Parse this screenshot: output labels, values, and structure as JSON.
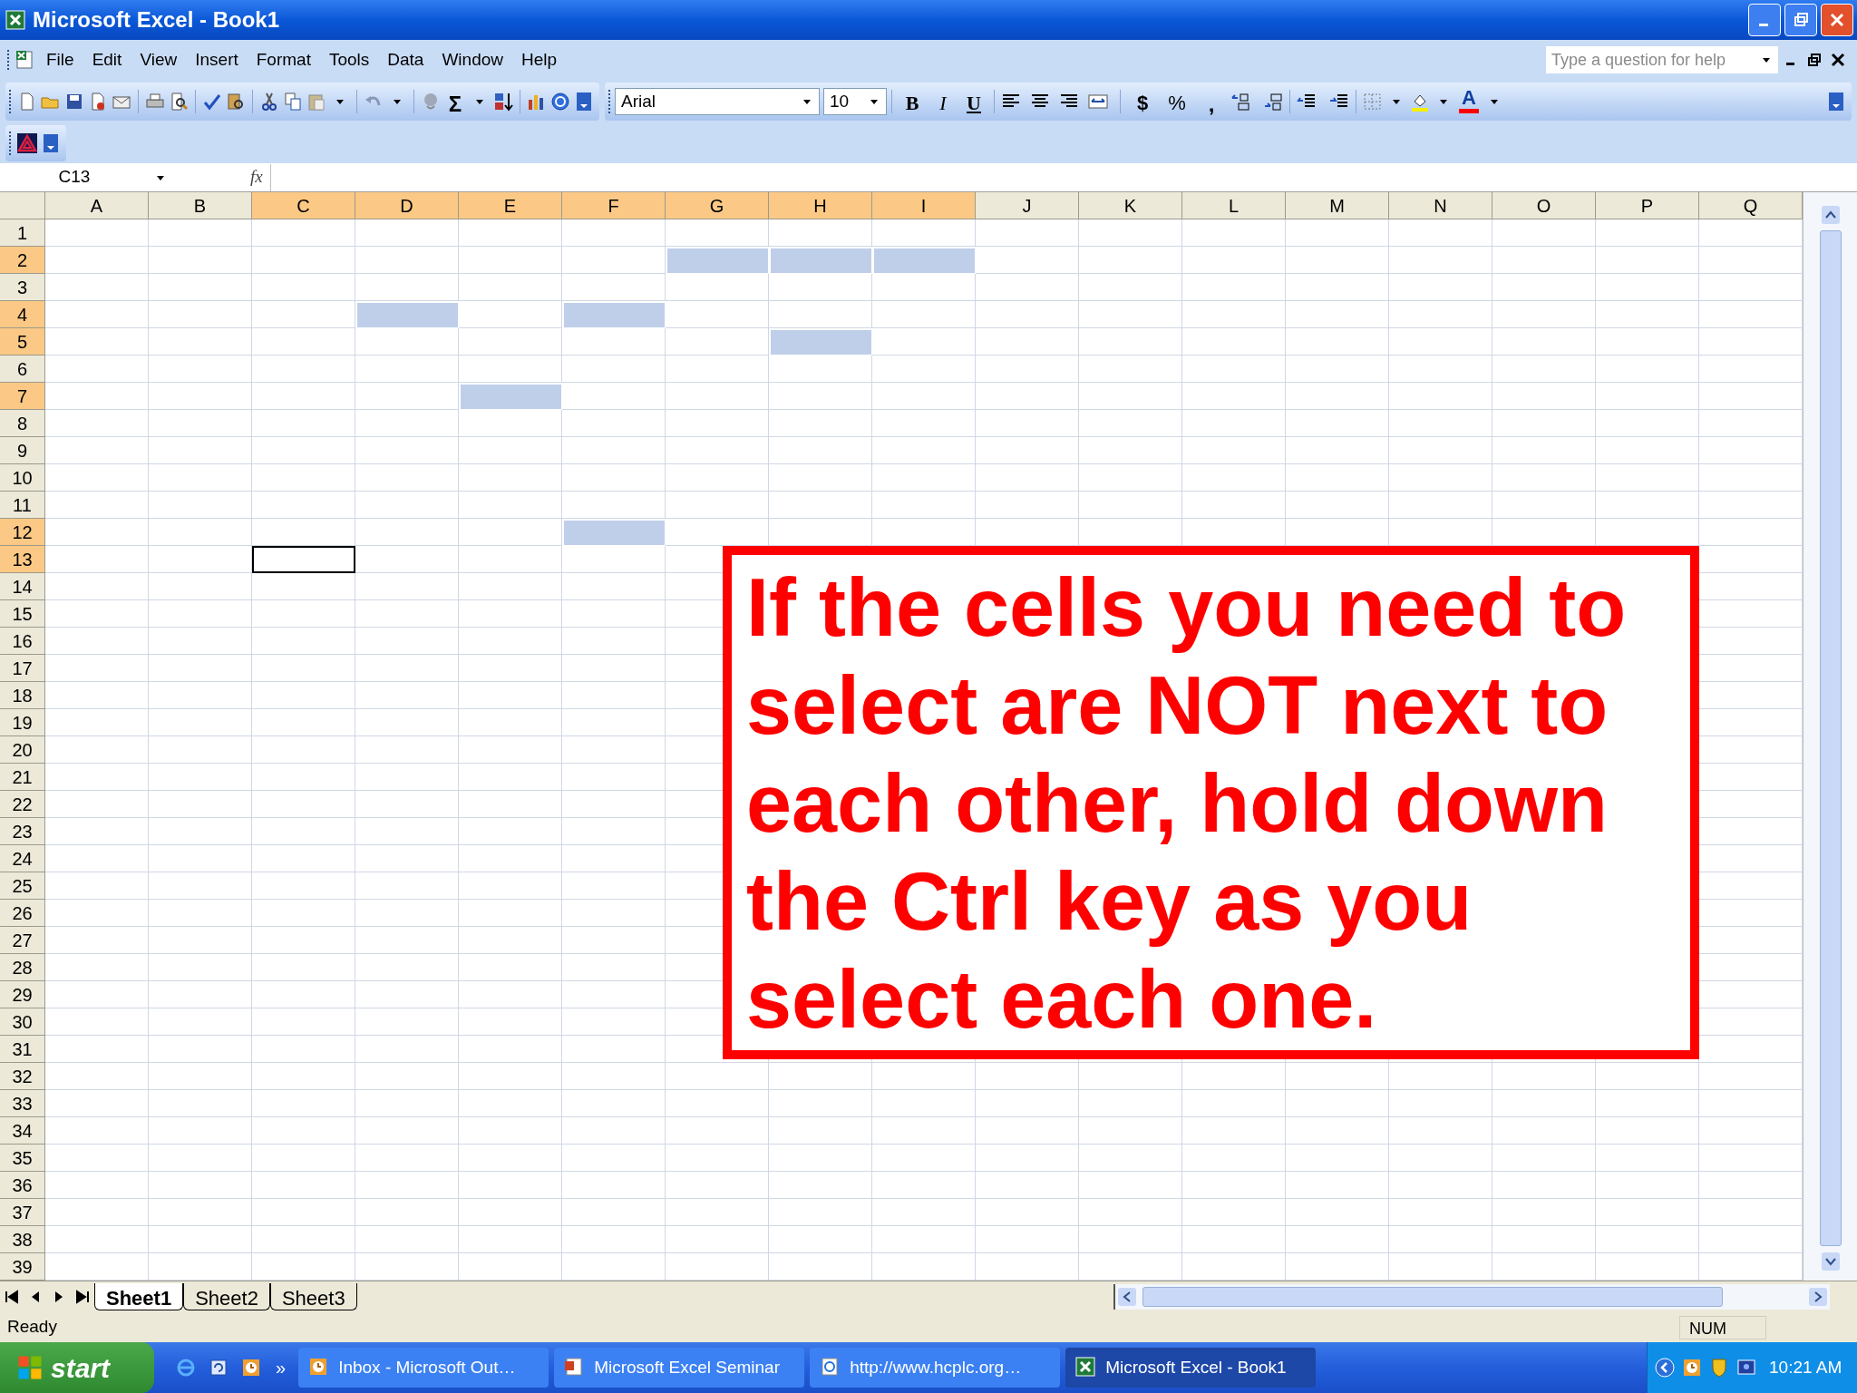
{
  "window": {
    "title": "Microsoft Excel - Book1"
  },
  "menu": [
    "File",
    "Edit",
    "View",
    "Insert",
    "Format",
    "Tools",
    "Data",
    "Window",
    "Help"
  ],
  "help_box": {
    "placeholder": "Type a question for help"
  },
  "standard_toolbar": {
    "autosum": "Σ"
  },
  "formatting_toolbar": {
    "font": "Arial",
    "size": "10",
    "bold": "B",
    "italic": "I",
    "underline": "U",
    "currency": "$",
    "percent": "%",
    "comma": ",",
    "font_color": "A"
  },
  "formula_bar": {
    "name_box": "C13",
    "fx": "fx"
  },
  "columns": [
    {
      "label": "A",
      "selected": false
    },
    {
      "label": "B",
      "selected": false
    },
    {
      "label": "C",
      "selected": true,
      "active": true
    },
    {
      "label": "D",
      "selected": true
    },
    {
      "label": "E",
      "selected": true
    },
    {
      "label": "F",
      "selected": true
    },
    {
      "label": "G",
      "selected": true
    },
    {
      "label": "H",
      "selected": true
    },
    {
      "label": "I",
      "selected": true
    },
    {
      "label": "J",
      "selected": false
    },
    {
      "label": "K",
      "selected": false
    },
    {
      "label": "L",
      "selected": false
    },
    {
      "label": "M",
      "selected": false
    },
    {
      "label": "N",
      "selected": false
    },
    {
      "label": "O",
      "selected": false
    },
    {
      "label": "P",
      "selected": false
    },
    {
      "label": "Q",
      "selected": false
    }
  ],
  "rows": [
    {
      "label": "1",
      "selected": false
    },
    {
      "label": "2",
      "selected": true,
      "cell_selected": [
        false,
        false,
        false,
        false,
        false,
        false,
        true,
        true,
        true,
        false,
        false,
        false,
        false,
        false,
        false,
        false,
        false
      ]
    },
    {
      "label": "3",
      "selected": false
    },
    {
      "label": "4",
      "selected": true,
      "cell_selected": [
        false,
        false,
        false,
        true,
        false,
        true,
        false,
        false,
        false,
        false,
        false,
        false,
        false,
        false,
        false,
        false,
        false
      ]
    },
    {
      "label": "5",
      "selected": true,
      "cell_selected": [
        false,
        false,
        false,
        false,
        false,
        false,
        false,
        true,
        false,
        false,
        false,
        false,
        false,
        false,
        false,
        false,
        false
      ]
    },
    {
      "label": "6",
      "selected": false
    },
    {
      "label": "7",
      "selected": true,
      "cell_selected": [
        false,
        false,
        false,
        false,
        true,
        false,
        false,
        false,
        false,
        false,
        false,
        false,
        false,
        false,
        false,
        false,
        false
      ]
    },
    {
      "label": "8",
      "selected": false
    },
    {
      "label": "9",
      "selected": false
    },
    {
      "label": "10",
      "selected": false
    },
    {
      "label": "11",
      "selected": false
    },
    {
      "label": "12",
      "selected": true,
      "cell_selected": [
        false,
        false,
        false,
        false,
        false,
        true,
        false,
        false,
        false,
        false,
        false,
        false,
        false,
        false,
        false,
        false,
        false
      ]
    },
    {
      "label": "13",
      "selected": true,
      "active": true
    },
    {
      "label": "14",
      "selected": false
    },
    {
      "label": "15",
      "selected": false
    },
    {
      "label": "16",
      "selected": false
    },
    {
      "label": "17",
      "selected": false
    },
    {
      "label": "18",
      "selected": false
    },
    {
      "label": "19",
      "selected": false
    },
    {
      "label": "20",
      "selected": false
    },
    {
      "label": "21",
      "selected": false
    },
    {
      "label": "22",
      "selected": false
    },
    {
      "label": "23",
      "selected": false
    },
    {
      "label": "24",
      "selected": false
    },
    {
      "label": "25",
      "selected": false
    },
    {
      "label": "26",
      "selected": false
    },
    {
      "label": "27",
      "selected": false
    },
    {
      "label": "28",
      "selected": false
    },
    {
      "label": "29",
      "selected": false
    },
    {
      "label": "30",
      "selected": false
    },
    {
      "label": "31",
      "selected": false
    },
    {
      "label": "32",
      "selected": false
    },
    {
      "label": "33",
      "selected": false
    },
    {
      "label": "34",
      "selected": false
    },
    {
      "label": "35",
      "selected": false
    },
    {
      "label": "36",
      "selected": false
    },
    {
      "label": "37",
      "selected": false
    },
    {
      "label": "38",
      "selected": false
    },
    {
      "label": "39",
      "selected": false
    }
  ],
  "callout": "If the cells you need to select are NOT next to each other, hold down the Ctrl key as you select each one.",
  "sheet_tabs": [
    {
      "label": "Sheet1",
      "selected": true
    },
    {
      "label": "Sheet2",
      "selected": false
    },
    {
      "label": "Sheet3",
      "selected": false
    }
  ],
  "status_bar": {
    "text": "Ready",
    "num": "NUM"
  },
  "taskbar": {
    "start": "start",
    "more": "»",
    "tasks": [
      {
        "label": "Inbox - Microsoft Out…",
        "selected": false
      },
      {
        "label": "Microsoft Excel Seminar",
        "selected": false
      },
      {
        "label": "http://www.hcplc.org…",
        "selected": false
      },
      {
        "label": "Microsoft Excel - Book1",
        "selected": true
      }
    ],
    "clock": "10:21 AM"
  }
}
